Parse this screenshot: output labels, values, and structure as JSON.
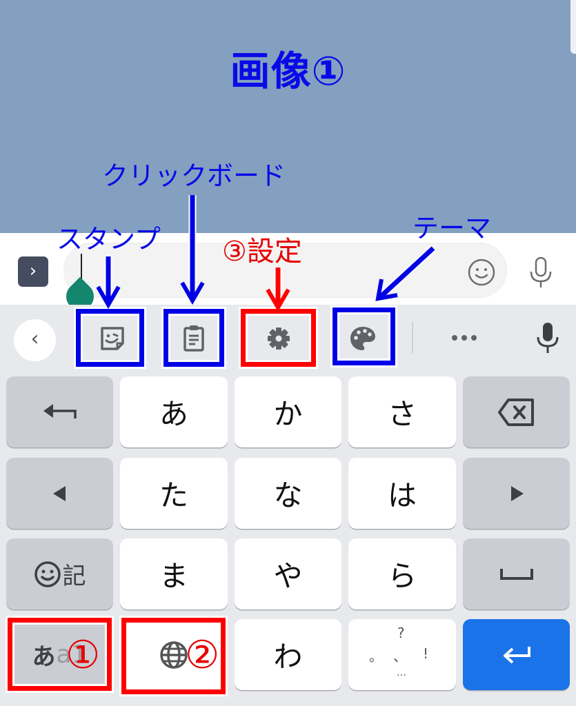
{
  "chat": {
    "title": "画像①"
  },
  "input_bar": {
    "expand_icon": "chevron-right-icon",
    "expand_glyph": "›",
    "text_value": "",
    "emoji_icon": "smiley-icon",
    "mic_icon": "microphone-icon"
  },
  "toolbar": {
    "back_glyph": "‹",
    "items": [
      {
        "name": "sticker",
        "icon": "sticker-icon"
      },
      {
        "name": "clipboard",
        "icon": "clipboard-icon"
      },
      {
        "name": "settings",
        "icon": "gear-icon"
      },
      {
        "name": "theme",
        "icon": "palette-icon"
      },
      {
        "name": "more",
        "icon": "more-dots-icon"
      },
      {
        "name": "voice",
        "icon": "microphone-icon"
      }
    ]
  },
  "annotations": {
    "stamp": "スタンプ",
    "clipboard": "クリックボード",
    "settings": "③設定",
    "theme": "テーマ",
    "mode_marker": "①",
    "globe_marker": "②"
  },
  "keyboard": {
    "rows": [
      [
        "undo",
        "あ",
        "か",
        "さ",
        "backspace"
      ],
      [
        "left",
        "た",
        "な",
        "は",
        "right"
      ],
      [
        "symbols",
        "ま",
        "や",
        "ら",
        "space"
      ],
      [
        "mode",
        "globe",
        "わ",
        "punct",
        "enter"
      ]
    ],
    "symbols_label": "記",
    "mode_label_primary": "あ",
    "mode_label_secondary": "a1",
    "punct": {
      "top": "?",
      "left": "。",
      "middle": "、",
      "right": "!",
      "bottom": "…"
    }
  },
  "colors": {
    "annotation_blue": "#0000e6",
    "annotation_red": "#ff0000",
    "enter_key": "#1a73e8",
    "chat_background": "#84a0c0"
  }
}
